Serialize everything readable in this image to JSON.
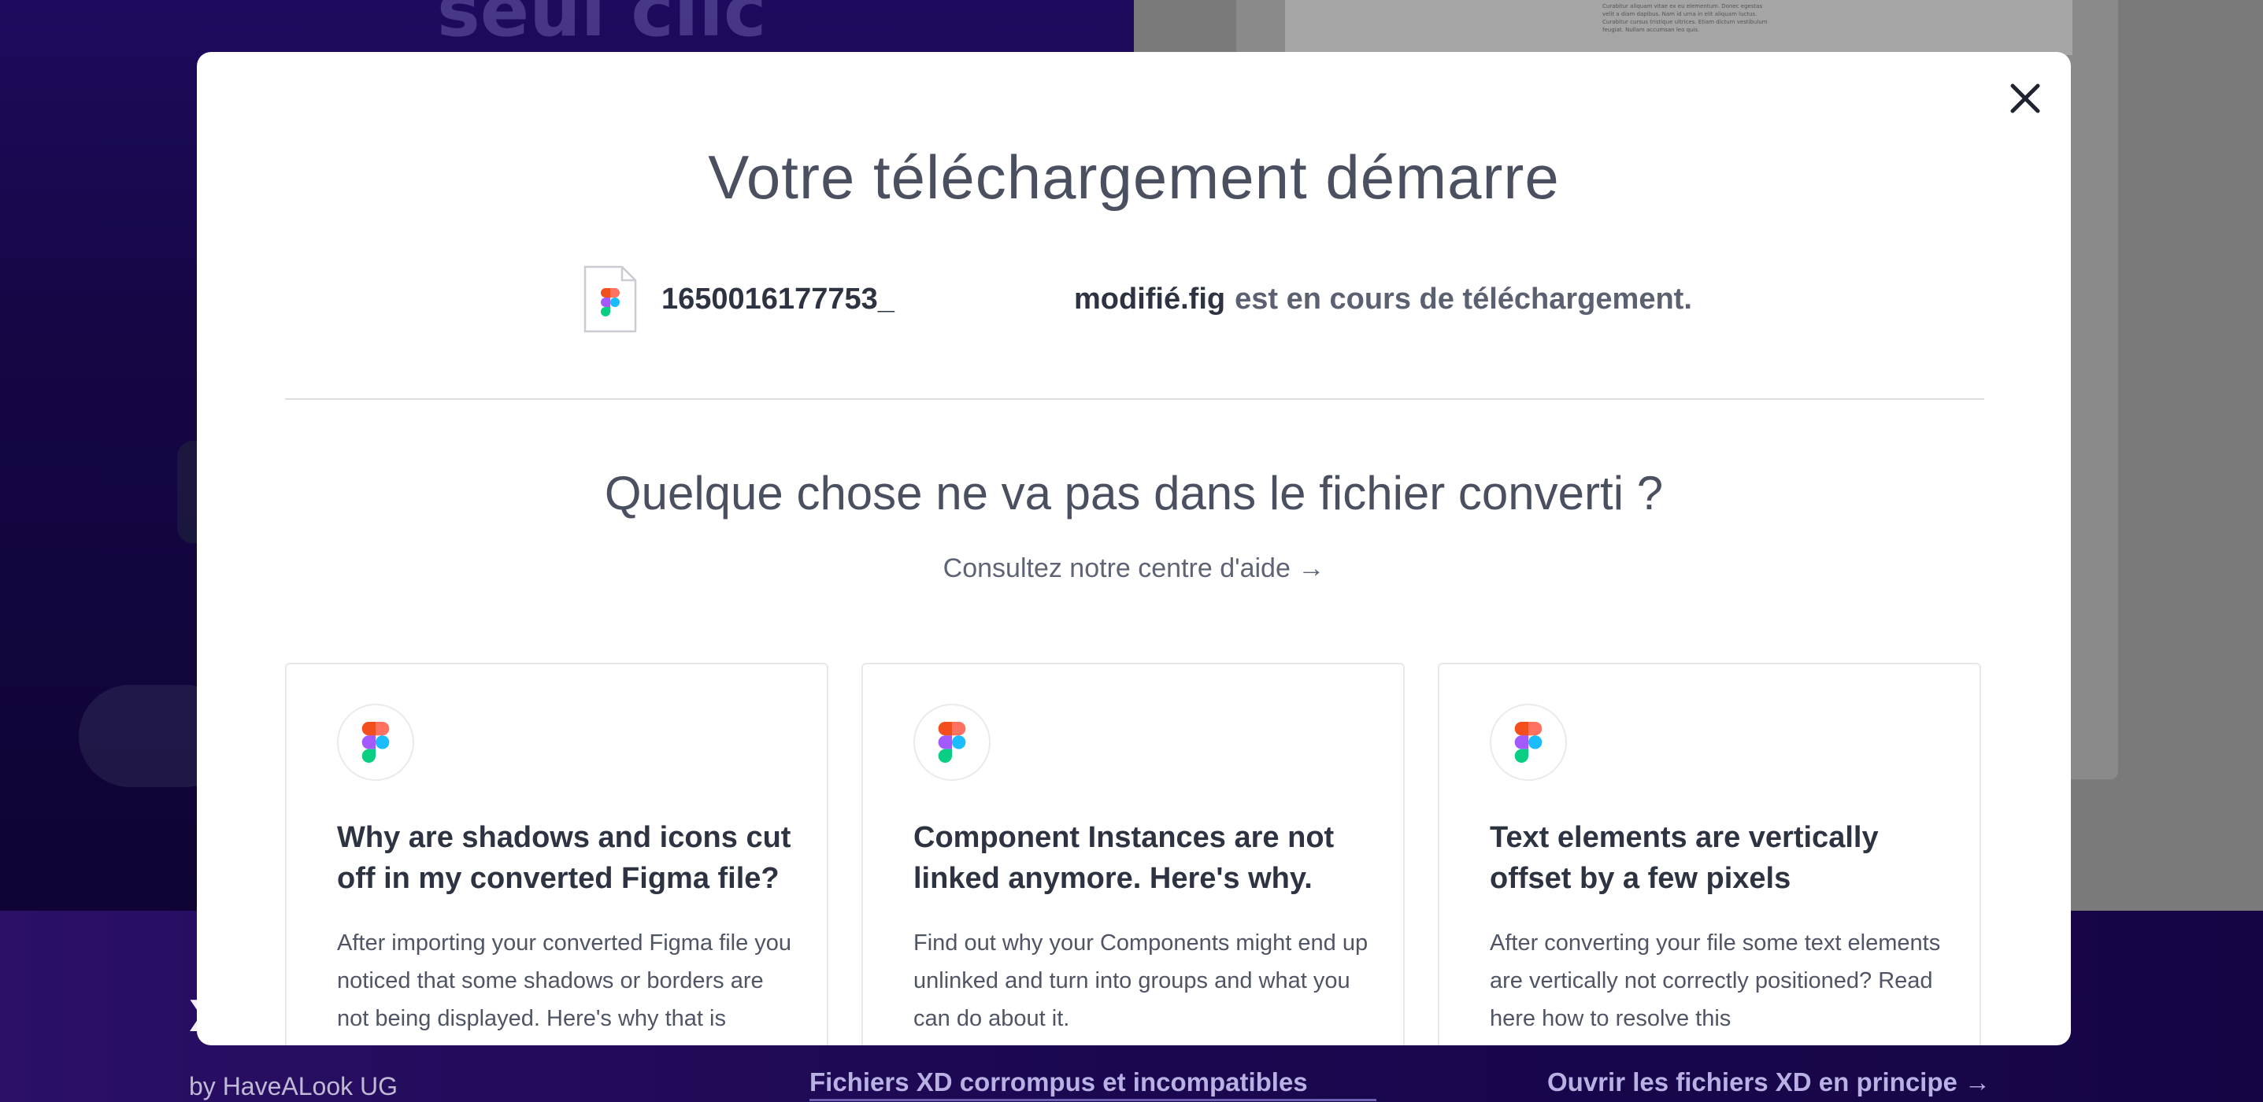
{
  "background": {
    "headline": "seul clic",
    "document_text": "Curabitur aliquam vitae ex eu elementum. Donec egestas velit a diam dapibus. Nam id urna in elit aliquam luctus. Curabitur cursus tristique ultrices. Etiam dictum vestibulum feugiat. Nullam accumsan leo quis.",
    "footer": {
      "brand": "X",
      "by": "by HaveALook UG",
      "link_corrupt": "Fichiers XD corrompus et incompatibles",
      "link_open": "Ouvrir les fichiers XD en principe →"
    }
  },
  "modal": {
    "title": "Votre téléchargement démarre",
    "file": {
      "name_part1": "1650016177753_",
      "name_part2": "modifié.fig",
      "status": "est en cours de téléchargement."
    },
    "subtitle": "Quelque chose ne va pas dans le fichier converti ?",
    "help_link": "Consultez notre centre d'aide →",
    "cards": [
      {
        "icon": "figma-icon",
        "title": "Why are shadows and icons cut off in my converted Figma file?",
        "text": "After importing your converted Figma file you noticed that some shadows or borders are not being displayed. Here's why that is"
      },
      {
        "icon": "figma-icon",
        "title": "Component Instances are not linked anymore. Here's why.",
        "text": "Find out why your Components might end up unlinked and turn into groups and what you can do about it."
      },
      {
        "icon": "figma-icon",
        "title": "Text elements are vertically offset by a few pixels",
        "text": "After converting your file some text elements are vertically not correctly positioned? Read here how to resolve this"
      }
    ]
  },
  "colors": {
    "background_left": "#160645",
    "background_right": "#7a7a7a",
    "modal_bg": "#ffffff",
    "title_text": "#4a5060",
    "figma_red": "#f24e1e",
    "figma_orange": "#ff7262",
    "figma_purple": "#a259ff",
    "figma_blue": "#1abcfe",
    "figma_green": "#0acf83"
  }
}
